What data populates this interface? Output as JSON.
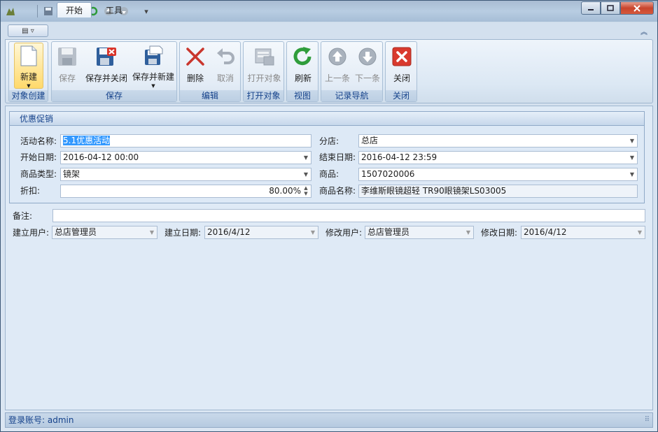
{
  "ribbon": {
    "tabs": [
      "开始",
      "工具"
    ],
    "groups": {
      "create": {
        "label": "对象创建",
        "new": "新建"
      },
      "save": {
        "label": "保存",
        "save": "保存",
        "save_close": "保存并关闭",
        "save_new": "保存并新建"
      },
      "edit": {
        "label": "编辑",
        "delete": "删除",
        "cancel": "取消"
      },
      "open": {
        "label": "打开对象",
        "open": "打开对象"
      },
      "view": {
        "label": "视图",
        "refresh": "刷新"
      },
      "nav": {
        "label": "记录导航",
        "prev": "上一条",
        "next": "下一条"
      },
      "close": {
        "label": "关闭",
        "close": "关闭"
      }
    }
  },
  "group_box": {
    "title": "优惠促销"
  },
  "form": {
    "activity_name": {
      "label": "活动名称:",
      "value": "5.1优惠活动"
    },
    "branch": {
      "label": "分店:",
      "value": "总店"
    },
    "start_date": {
      "label": "开始日期:",
      "value": "2016-04-12 00:00"
    },
    "end_date": {
      "label": "结束日期:",
      "value": "2016-04-12 23:59"
    },
    "product_type": {
      "label": "商品类型:",
      "value": "镜架"
    },
    "product": {
      "label": "商品:",
      "value": "1507020006"
    },
    "discount": {
      "label": "折扣:",
      "value": "80.00%"
    },
    "product_name": {
      "label": "商品名称:",
      "value": "李维斯眼镜超轻 TR90眼镜架LS03005"
    },
    "remark": {
      "label": "备注:",
      "value": ""
    },
    "created_by": {
      "label": "建立用户:",
      "value": "总店管理员"
    },
    "created_date": {
      "label": "建立日期:",
      "value": "2016/4/12"
    },
    "modified_by": {
      "label": "修改用户:",
      "value": "总店管理员"
    },
    "modified_date": {
      "label": "修改日期:",
      "value": "2016/4/12"
    }
  },
  "status": {
    "login": "登录账号: admin"
  },
  "colors": {
    "accent": "#15428b",
    "selection": "#3399ff"
  }
}
